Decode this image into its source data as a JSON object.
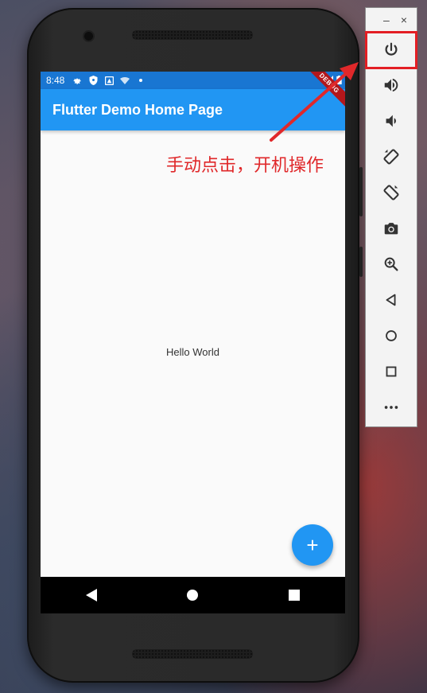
{
  "status_bar": {
    "time": "8:48"
  },
  "app_bar": {
    "title": "Flutter Demo Home Page"
  },
  "debug_banner": "DEBUG",
  "body": {
    "text": "Hello World"
  },
  "fab": {
    "label": "+"
  },
  "annotation": {
    "text": "手动点击，开机操作"
  },
  "toolbar": {
    "window_minimize": "–",
    "window_close": "×",
    "buttons": [
      {
        "icon": "power-icon"
      },
      {
        "icon": "volume-up-icon"
      },
      {
        "icon": "volume-down-icon"
      },
      {
        "icon": "rotate-left-icon"
      },
      {
        "icon": "rotate-right-icon"
      },
      {
        "icon": "camera-icon"
      },
      {
        "icon": "zoom-icon"
      },
      {
        "icon": "back-icon"
      },
      {
        "icon": "home-icon"
      },
      {
        "icon": "overview-icon"
      },
      {
        "icon": "more-icon"
      }
    ]
  },
  "colors": {
    "primary": "#2196f3",
    "status_bar": "#1976d2",
    "annotation": "#e0282a",
    "debug": "#b3171b"
  }
}
